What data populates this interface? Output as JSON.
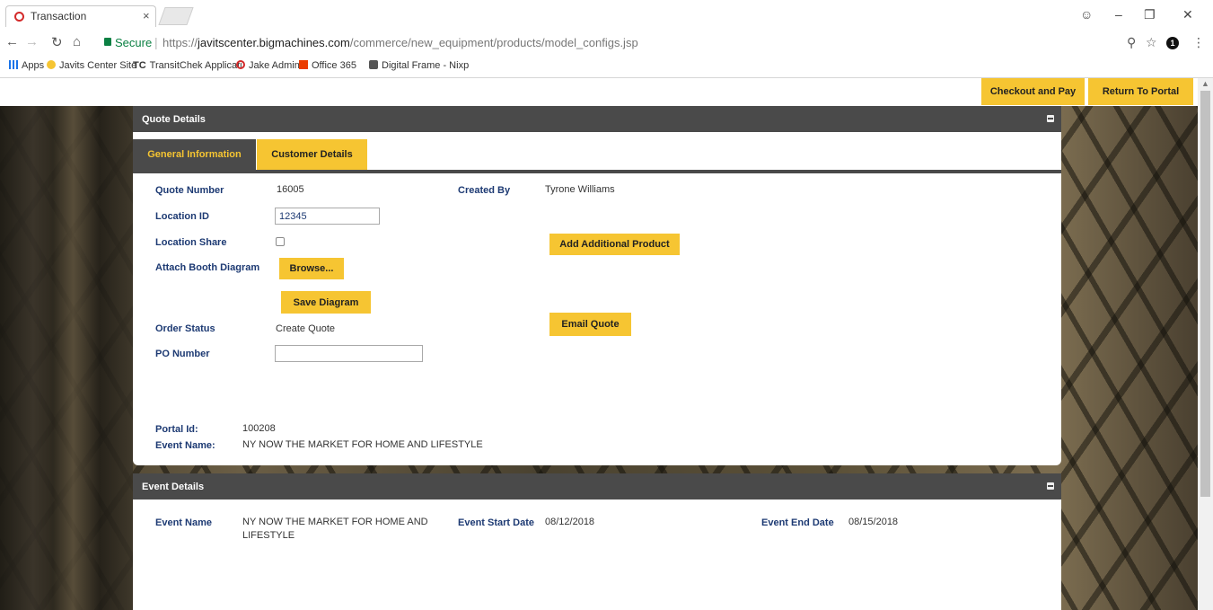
{
  "browser": {
    "tab_title": "Transaction",
    "tab_close": "×",
    "secure_label": "Secure",
    "url_scheme": "https://",
    "url_host": "javitscenter.bigmachines.com",
    "url_path": "/commerce/new_equipment/products/model_configs.jsp",
    "bookmarks": [
      {
        "label": "Apps",
        "icon": "apps-grid-icon",
        "color": "#1a73e8"
      },
      {
        "label": "Javits Center Site",
        "icon": "javits-icon",
        "color": "#f6c532"
      },
      {
        "label": "TransitChek Applicati",
        "icon": "tc-icon",
        "prefix": "TC",
        "color": "#222222"
      },
      {
        "label": "Jake Admin",
        "icon": "oracle-icon",
        "color": "#d32a2a"
      },
      {
        "label": "Office 365",
        "icon": "office-icon",
        "color": "#eb3c00"
      },
      {
        "label": "Digital Frame - Nixp",
        "icon": "nixplay-icon",
        "color": "#555555"
      }
    ]
  },
  "page": {
    "checkout_label": "Checkout and Pay",
    "return_label": "Return To Portal",
    "accent_color": "#f6c532",
    "header_color": "#4a4a4a",
    "label_color": "#1d3a73"
  },
  "quote_details": {
    "title": "Quote Details",
    "tabs": [
      "General Information",
      "Customer Details"
    ],
    "quote_number_label": "Quote Number",
    "quote_number": "16005",
    "created_by_label": "Created By",
    "created_by": "Tyrone Williams",
    "location_id_label": "Location ID",
    "location_id": "12345",
    "location_share_label": "Location Share",
    "location_share_checked": false,
    "attach_label": "Attach Booth Diagram",
    "browse_label": "Browse...",
    "save_diagram_label": "Save Diagram",
    "add_product_label": "Add Additional Product",
    "order_status_label": "Order Status",
    "order_status": "Create Quote",
    "email_quote_label": "Email Quote",
    "po_number_label": "PO Number",
    "po_number": "",
    "portal_id_label": "Portal Id:",
    "portal_id": "100208",
    "event_name_label": "Event Name:",
    "event_name": "NY NOW THE MARKET FOR HOME AND LIFESTYLE"
  },
  "event_details": {
    "title": "Event Details",
    "event_name_label": "Event Name",
    "event_name_line1": "NY NOW THE MARKET FOR HOME AND",
    "event_name_line2": "LIFESTYLE",
    "start_label": "Event Start Date",
    "start_date": "08/12/2018",
    "end_label": "Event End Date",
    "end_date": "08/15/2018"
  }
}
